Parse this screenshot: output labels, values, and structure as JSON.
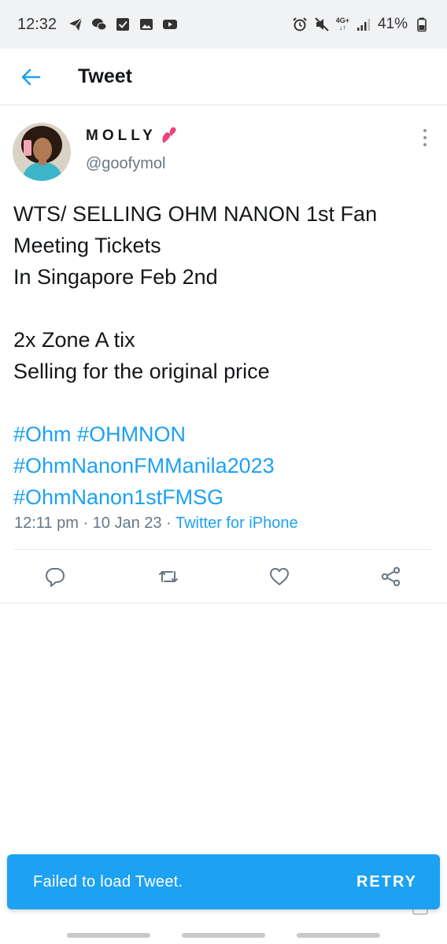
{
  "status_bar": {
    "time": "12:32",
    "left_icons": [
      "send-icon",
      "wechat-icon",
      "check-box-icon",
      "image-icon",
      "youtube-icon"
    ],
    "right_icons": [
      "alarm-icon",
      "mute-icon",
      "network-icon",
      "signal-icon",
      "battery-icon"
    ],
    "network_label_top": "4G+",
    "network_label_bottom": "↓↑",
    "battery": "41%"
  },
  "header": {
    "back_icon": "back-arrow-icon",
    "title": "Tweet"
  },
  "tweet": {
    "author": {
      "name": "MOLLY",
      "emoji": "two-hearts-emoji",
      "handle": "@goofymol"
    },
    "text_lines": [
      "WTS/ SELLING OHM NANON 1st Fan",
      "Meeting Tickets",
      "In Singapore Feb 2nd",
      "",
      "2x Zone A tix",
      "Selling for the original price",
      ""
    ],
    "hashtags_line1": [
      "#Ohm",
      "#OHMNON"
    ],
    "hashtags_line2": [
      "#OhmNanonFMManila2023"
    ],
    "hashtags_line3": [
      "#OhmNanon1stFMSG"
    ],
    "timestamp": "12:11 pm · 10 Jan 23 · ",
    "source": "Twitter for iPhone"
  },
  "actions": {
    "reply_icon": "reply-icon",
    "retweet_icon": "retweet-icon",
    "like_icon": "like-icon",
    "share_icon": "share-icon"
  },
  "snackbar": {
    "message": "Failed to load Tweet.",
    "action": "RETRY"
  },
  "colors": {
    "accent": "#1da1f2",
    "secondary_text": "#657786",
    "status_bar_bg": "#f1f2f4"
  }
}
